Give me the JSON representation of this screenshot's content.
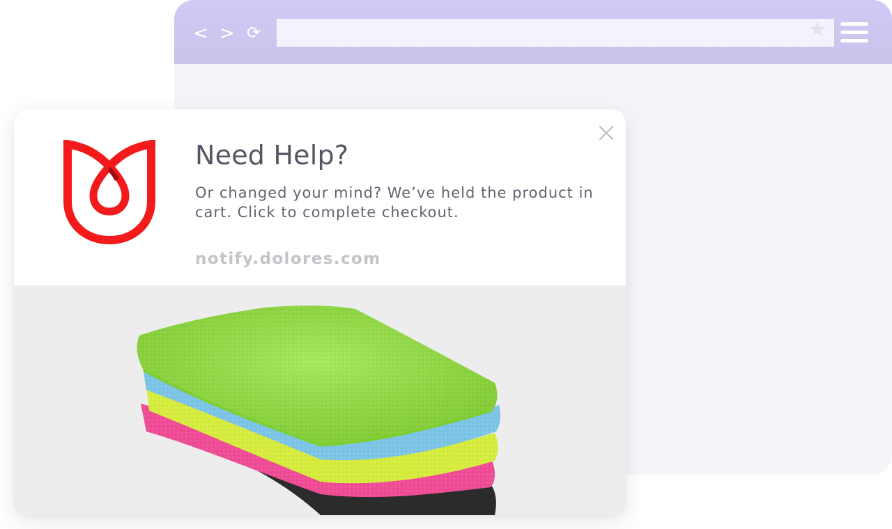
{
  "browser": {
    "back_glyph": "<",
    "forward_glyph": ">",
    "reload_glyph": "⟳",
    "star_glyph": "★",
    "address_value": "",
    "icons": [
      "back-icon",
      "forward-icon",
      "reload-icon",
      "star-icon",
      "hamburger-menu-icon"
    ]
  },
  "notification": {
    "title": "Need Help?",
    "message": "Or changed your mind? We’ve held the product in cart. Click to complete checkout.",
    "domain": "notify.dolores.com",
    "icons": [
      "brand-logo",
      "close-icon"
    ],
    "product_image": "stacked-microfiber-towels"
  },
  "colors": {
    "browser_bar": "#cfc8f5",
    "browser_body": "#f5f5f9",
    "logo_red": "#f21a1a",
    "title_text": "#545664",
    "body_text": "#606370",
    "domain_text": "#c3c3c8",
    "towel_green": "#92e53a",
    "towel_blue": "#7cc4e6",
    "towel_yellow": "#d6ec3e",
    "towel_pink": "#ef4c95",
    "towel_black": "#2b2b2b"
  }
}
